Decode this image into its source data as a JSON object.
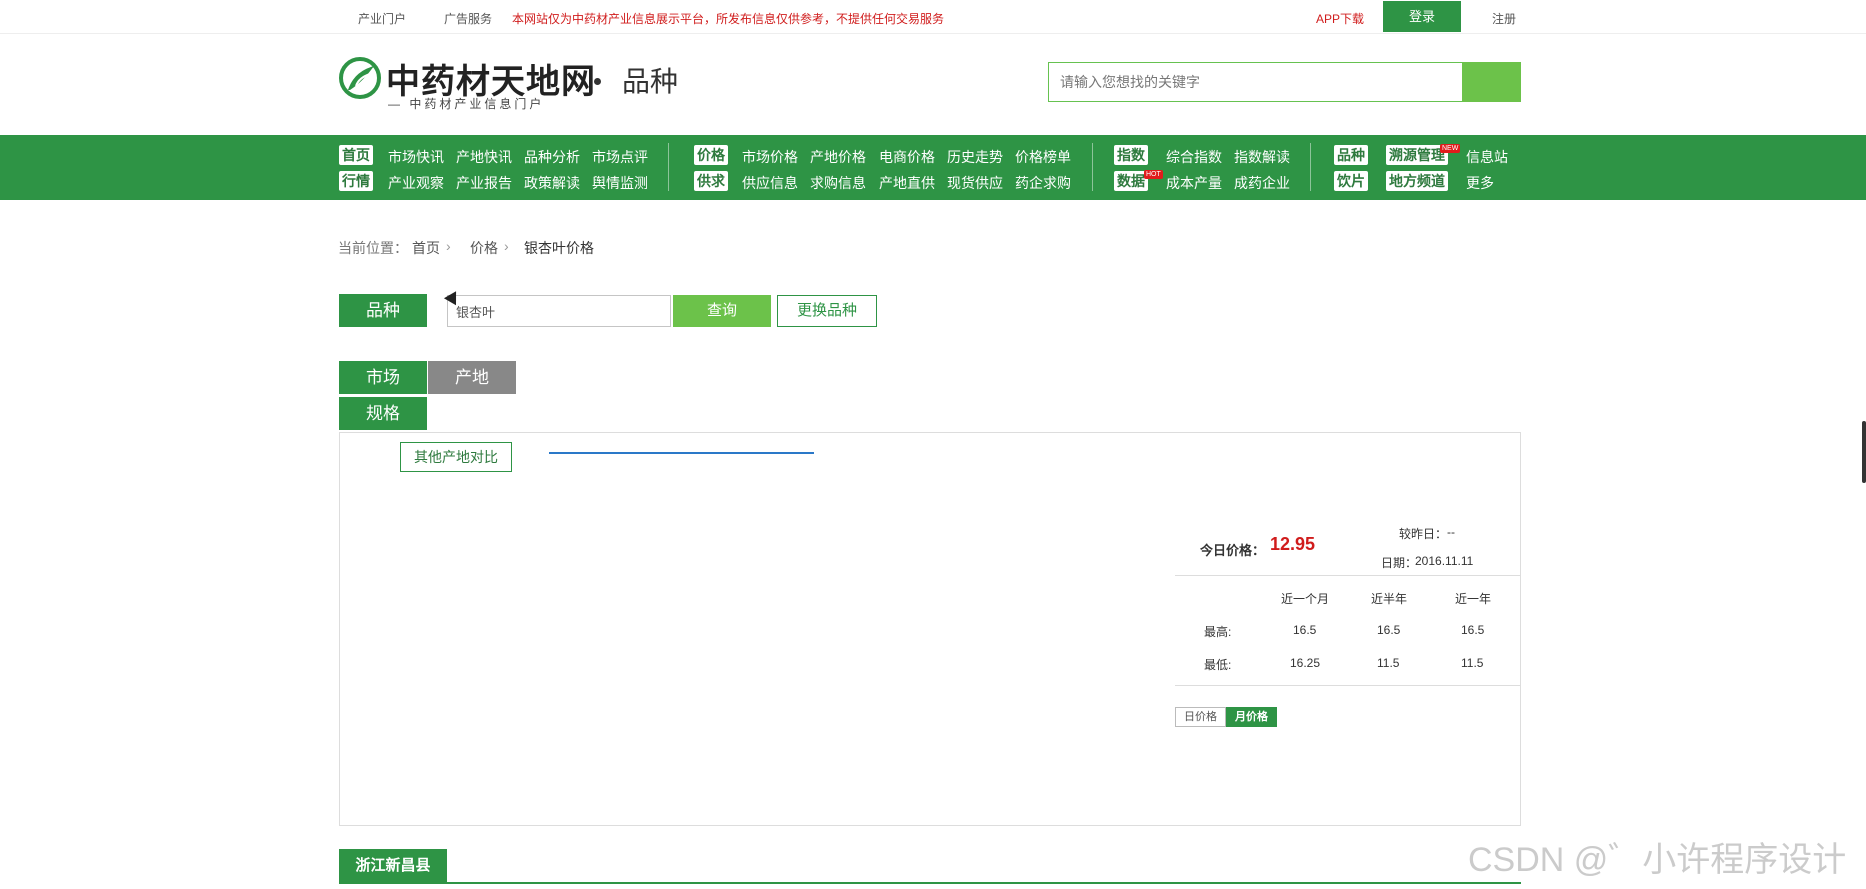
{
  "topbar": {
    "link_portal": "产业门户",
    "link_ads": "广告服务",
    "notice": "本网站仅为中药材产业信息展示平台，所发布信息仅供参考，不提供任何交易服务",
    "app_download": "APP下载",
    "login": "登录",
    "register": "注册"
  },
  "brand": {
    "name": "中药材天地网",
    "tagline": "— 中药材产业信息门户",
    "section": "品种"
  },
  "search": {
    "placeholder": "请输入您想找的关键字"
  },
  "nav": {
    "group1_row1": [
      "首页",
      "市场快讯",
      "产地快讯",
      "品种分析",
      "市场点评"
    ],
    "group1_row2": [
      "行情",
      "产业观察",
      "产业报告",
      "政策解读",
      "舆情监测"
    ],
    "group2_row1": [
      "价格",
      "市场价格",
      "产地价格",
      "电商价格",
      "历史走势",
      "价格榜单"
    ],
    "group2_row2": [
      "供求",
      "供应信息",
      "求购信息",
      "产地直供",
      "现货供应",
      "药企求购"
    ],
    "group3_row1": [
      "指数",
      "综合指数",
      "指数解读"
    ],
    "group3_row2": [
      "数据",
      "成本产量",
      "成药企业"
    ],
    "group4_row1": [
      "品种",
      "溯源管理",
      "信息站"
    ],
    "group4_row2": [
      "饮片",
      "地方频道",
      "更多"
    ],
    "badge_new": "NEW",
    "badge_hot": "HOT"
  },
  "breadcrumb": {
    "prefix": "当前位置：",
    "home": "首页",
    "price": "价格",
    "current": "银杏叶价格"
  },
  "query": {
    "label": "品种",
    "value": "银杏叶",
    "query_button": "查询",
    "change_button": "更换品种"
  },
  "tabs": {
    "market": "市场",
    "origin": "产地",
    "spec": "规格"
  },
  "panel": {
    "compare_button": "其他产地对比",
    "today_price_label": "今日价格：",
    "today_price": "12.95",
    "vs_yesterday_label": "较昨日：",
    "vs_yesterday": "--",
    "date_label": "日期：",
    "date": "2016.11.11",
    "columns": [
      "近一个月",
      "近半年",
      "近一年"
    ],
    "rows": [
      {
        "label": "最高:",
        "values": [
          "16.5",
          "16.5",
          "16.5"
        ]
      },
      {
        "label": "最低:",
        "values": [
          "16.25",
          "11.5",
          "11.5"
        ]
      }
    ],
    "toggle_daily": "日价格",
    "toggle_monthly": "月价格"
  },
  "region": {
    "name": "浙江新昌县"
  },
  "watermark": "CSDN @゛小许程序设计",
  "colors": {
    "primary_green": "#2e9445",
    "light_green": "#6cc24a",
    "price_red": "#d01c1c",
    "chart_line": "#2a78c8"
  }
}
